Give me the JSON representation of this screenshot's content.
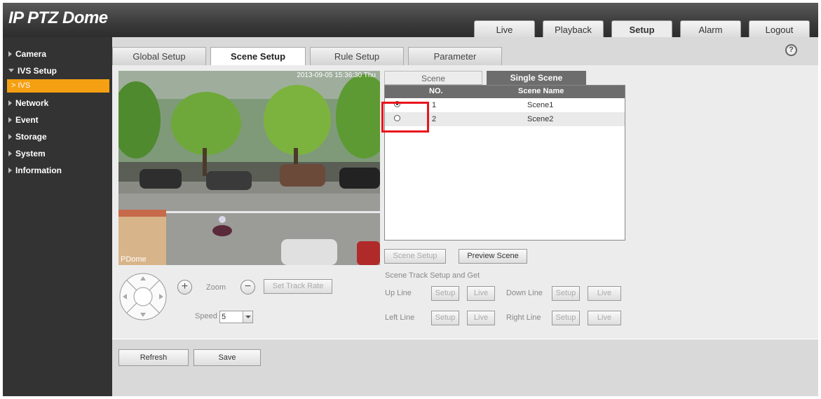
{
  "app": {
    "title": "IP PTZ Dome"
  },
  "nav": {
    "tabs": [
      {
        "label": "Live"
      },
      {
        "label": "Playback"
      },
      {
        "label": "Setup"
      },
      {
        "label": "Alarm"
      },
      {
        "label": "Logout"
      }
    ],
    "active": "Setup"
  },
  "sidebar": {
    "items": [
      {
        "label": "Camera"
      },
      {
        "label": "IVS Setup"
      },
      {
        "label": "Network"
      },
      {
        "label": "Event"
      },
      {
        "label": "Storage"
      },
      {
        "label": "System"
      },
      {
        "label": "Information"
      }
    ],
    "sub_active": "IVS"
  },
  "subtabs": [
    {
      "label": "Global Setup"
    },
    {
      "label": "Scene Setup"
    },
    {
      "label": "Rule Setup"
    },
    {
      "label": "Parameter"
    }
  ],
  "video": {
    "timestamp": "2013-09-05 15:36:30 Thu",
    "label": "PDome"
  },
  "ptz": {
    "zoom_label": "Zoom",
    "zoom_in": "+",
    "zoom_out": "−",
    "set_track_rate": "Set Track Rate",
    "speed_label": "Speed",
    "speed_value": "5"
  },
  "scene": {
    "tabs": [
      {
        "label": "Scene"
      },
      {
        "label": "Single Scene"
      }
    ],
    "columns": {
      "no": "NO.",
      "name": "Scene Name"
    },
    "rows": [
      {
        "no": "1",
        "name": "Scene1",
        "selected": true
      },
      {
        "no": "2",
        "name": "Scene2",
        "selected": false
      }
    ],
    "scene_setup": "Scene Setup",
    "preview_scene": "Preview Scene",
    "track_title": "Scene Track Setup and Get",
    "up_line": "Up Line",
    "down_line": "Down Line",
    "left_line": "Left Line",
    "right_line": "Right Line",
    "setup": "Setup",
    "live": "Live"
  },
  "footer": {
    "refresh": "Refresh",
    "save": "Save"
  }
}
